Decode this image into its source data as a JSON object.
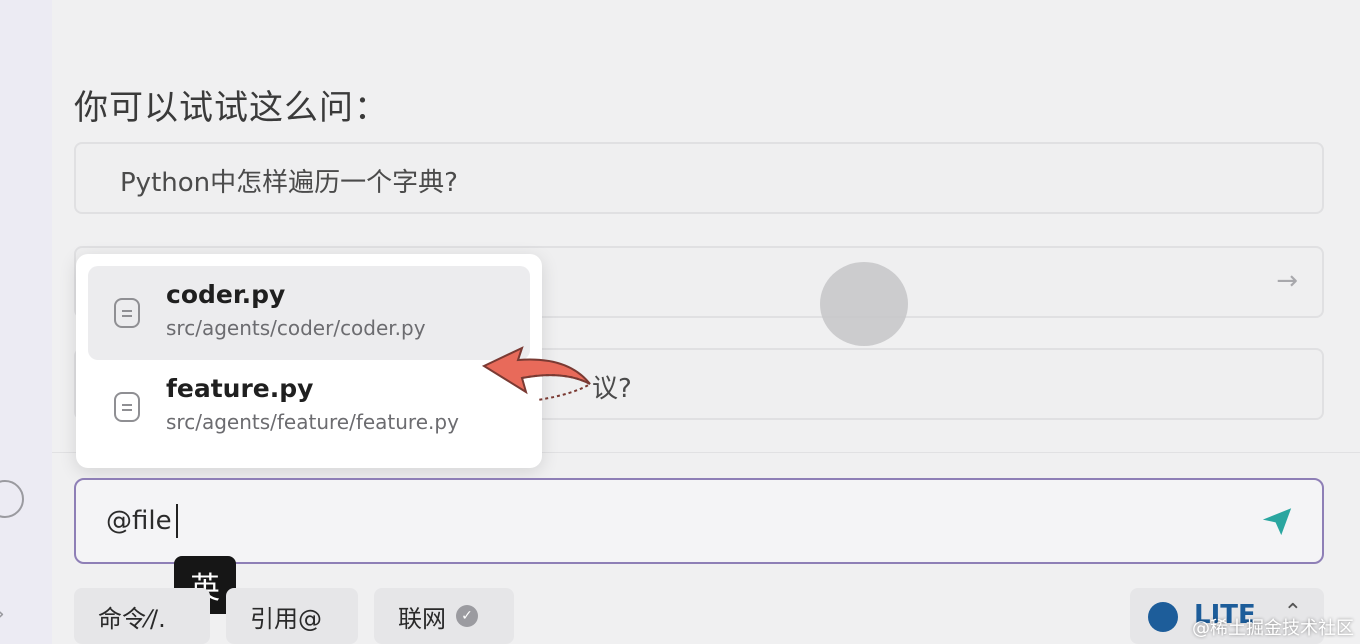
{
  "heading": "你可以试试这么问：",
  "suggestions": [
    {
      "text": "Python中怎样遍历一个字典?"
    },
    {
      "text": ""
    },
    {
      "text": "议?"
    }
  ],
  "file_popup": {
    "items": [
      {
        "name": "coder.py",
        "path": "src/agents/coder/coder.py"
      },
      {
        "name": "feature.py",
        "path": "src/agents/feature/feature.py"
      }
    ]
  },
  "input": {
    "value": "@file"
  },
  "ime_badge": "英",
  "toolbar": {
    "command": "命令⁄/.",
    "quote": "引用@",
    "web": "联网"
  },
  "model": {
    "label": "LITE"
  },
  "watermark": "@稀土掘金技术社区",
  "colors": {
    "accent_border": "#8e7fb6",
    "send_icon": "#2aa6a0",
    "annotation_arrow": "#e86a5a"
  }
}
